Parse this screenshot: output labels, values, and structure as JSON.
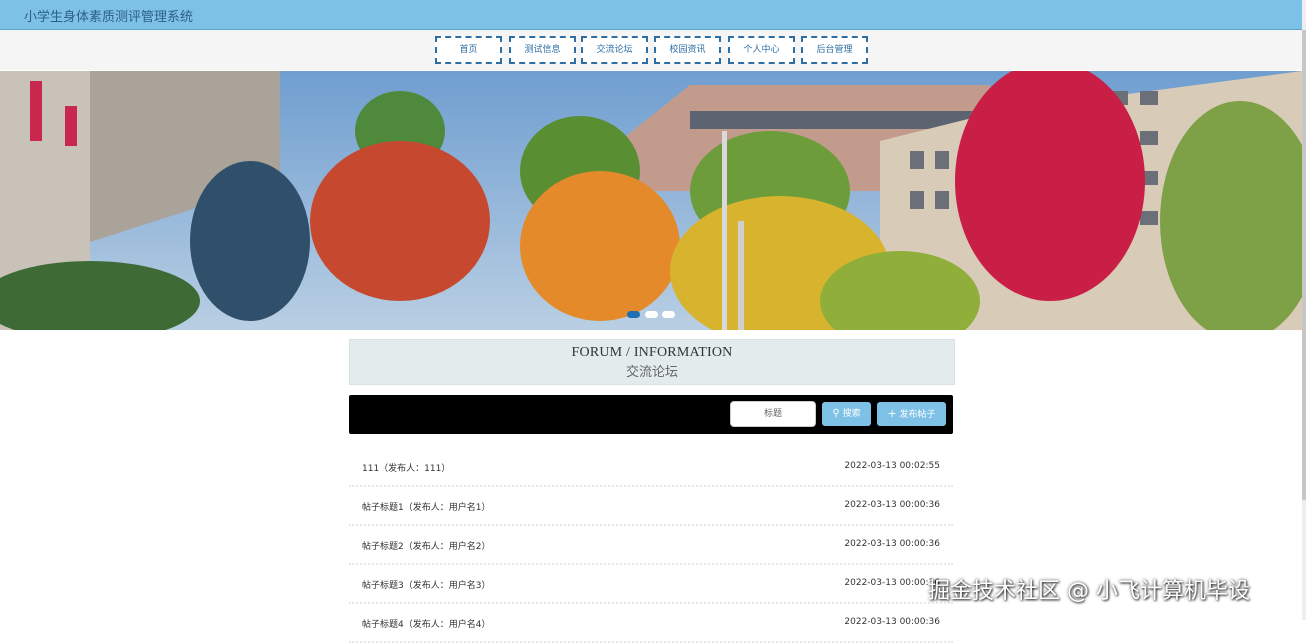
{
  "app": {
    "title": "小学生身体素质测评管理系统"
  },
  "nav": {
    "items": [
      "首页",
      "测试信息",
      "交流论坛",
      "校园资讯",
      "个人中心",
      "后台管理"
    ]
  },
  "banner": {
    "slide_count": 3,
    "active_slide": 1
  },
  "section": {
    "title_en": "FORUM / INFORMATION",
    "title_zh": "交流论坛"
  },
  "search": {
    "placeholder": "标题",
    "search_label": "搜索",
    "post_label": "发布帖子"
  },
  "posts": [
    {
      "title": "111（发布人：111）",
      "date": "2022-03-13 00:02:55"
    },
    {
      "title": "帖子标题1（发布人：用户名1）",
      "date": "2022-03-13 00:00:36"
    },
    {
      "title": "帖子标题2（发布人：用户名2）",
      "date": "2022-03-13 00:00:36"
    },
    {
      "title": "帖子标题3（发布人：用户名3）",
      "date": "2022-03-13 00:00:36"
    },
    {
      "title": "帖子标题4（发布人：用户名4）",
      "date": "2022-03-13 00:00:36"
    }
  ],
  "watermark": "掘金技术社区 @ 小飞计算机毕设",
  "colors": {
    "topbar": "#7ec1e6",
    "nav_border": "#2d6ea5",
    "button": "#7ec1e6"
  }
}
